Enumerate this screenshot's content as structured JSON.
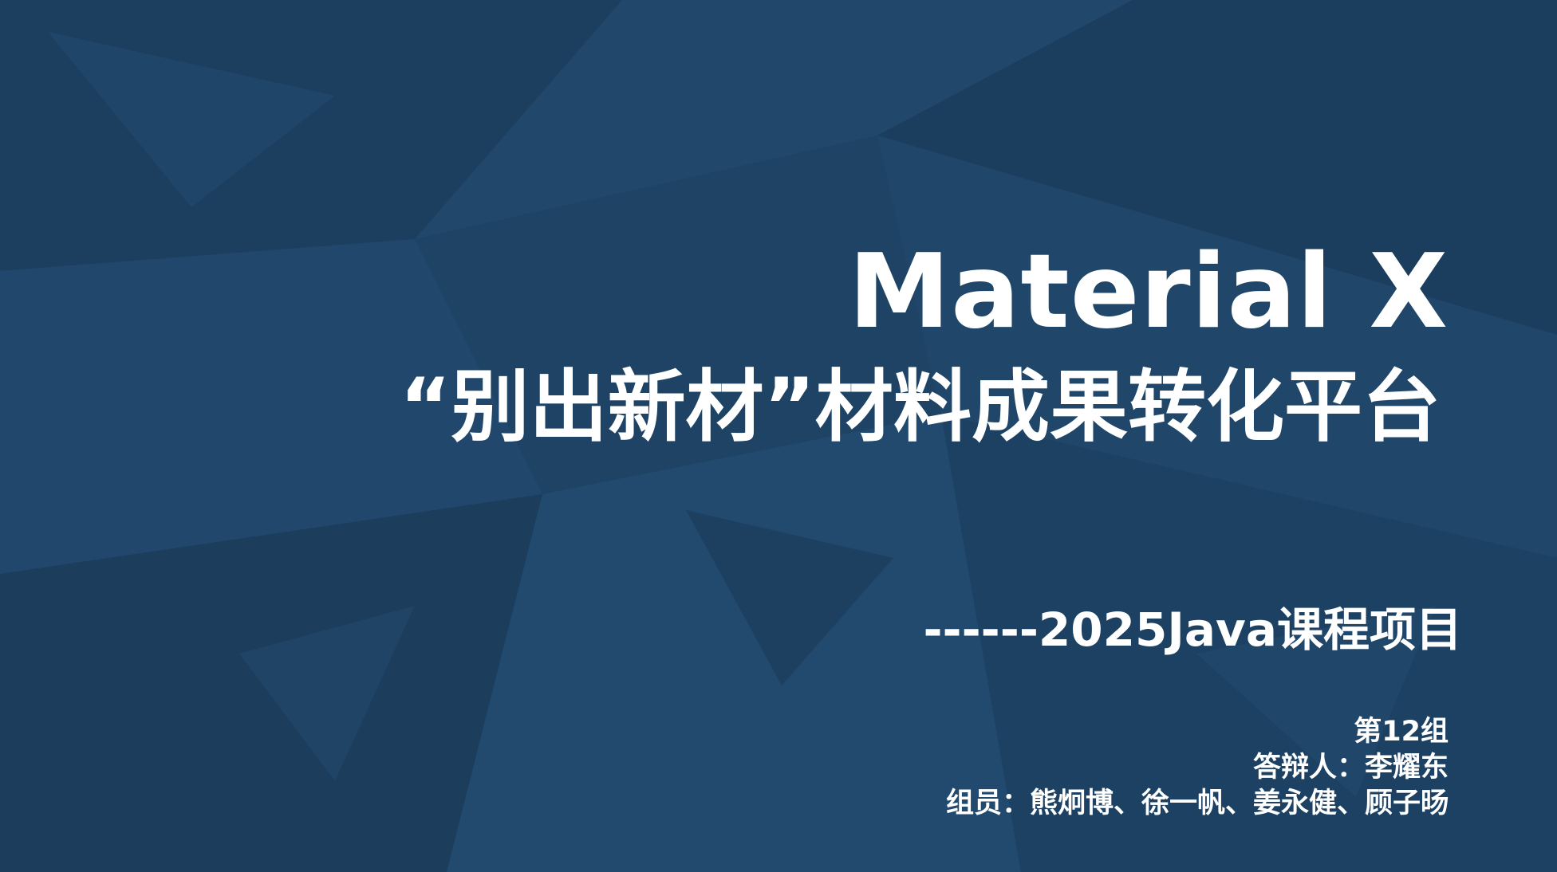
{
  "slide": {
    "title_en": "Material X",
    "title_cn": "“别出新材”材料成果转化平台",
    "subtitle": "------2025Java课程项目",
    "group": "第12组",
    "presenter": "答辩人：李耀东",
    "members": "组员：熊炯博、徐一帆、姜永健、顾子旸"
  },
  "colors": {
    "background": "#1f4466",
    "text": "#ffffff"
  }
}
